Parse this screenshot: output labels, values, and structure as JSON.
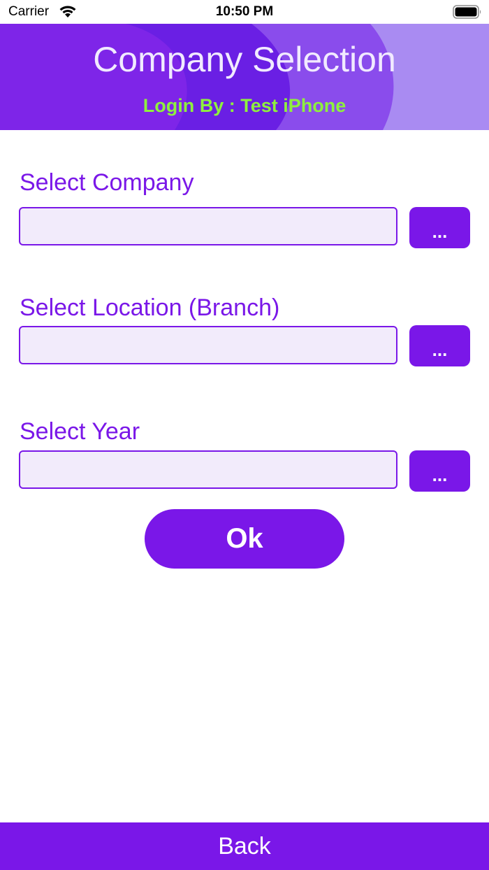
{
  "status_bar": {
    "carrier": "Carrier",
    "time": "10:50 PM",
    "icons": [
      "wifi-icon",
      "battery-icon"
    ]
  },
  "header": {
    "title": "Company Selection",
    "subtitle": "Login By : Test iPhone"
  },
  "form": {
    "company": {
      "label": "Select Company",
      "value": "",
      "button_label": "..."
    },
    "location": {
      "label": "Select Location (Branch)",
      "value": "",
      "button_label": "..."
    },
    "year": {
      "label": "Select Year",
      "value": "",
      "button_label": "..."
    }
  },
  "ok_label": "Ok",
  "back_label": "Back",
  "colors": {
    "accent": "#7a17e8",
    "header": "#6a1fe4",
    "subtitle": "#8ef03e",
    "input_bg": "#f2ebfb"
  }
}
